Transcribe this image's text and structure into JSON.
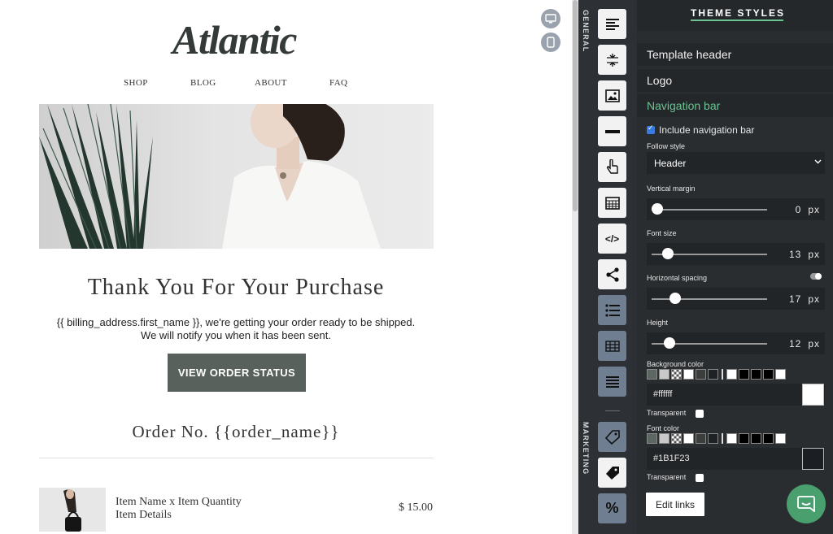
{
  "email": {
    "logo": "Atlantic",
    "nav": [
      "SHOP",
      "BLOG",
      "ABOUT",
      "FAQ"
    ],
    "title": "Thank You For Your Purchase",
    "message_line1": "{{ billing_address.first_name }}, we're getting your order ready to be shipped.",
    "message_line2": "We will notify you when it has been sent.",
    "cta_label": "VIEW ORDER STATUS",
    "order_label": "Order No. {{order_name}}",
    "item_line1": "Item Name x Item Quantity",
    "item_line2": "Item Details",
    "price": "$ 15.00"
  },
  "rail": {
    "general_label": "GENERAL",
    "marketing_label": "MARKETING",
    "tools": [
      {
        "icon": "header-align-icon"
      },
      {
        "icon": "spacer-icon"
      },
      {
        "icon": "image-icon"
      },
      {
        "icon": "divider-icon"
      },
      {
        "icon": "button-pointer-icon"
      },
      {
        "icon": "grid-block-icon"
      },
      {
        "icon": "html-code-icon",
        "text": "</>"
      },
      {
        "icon": "share-icon"
      },
      {
        "icon": "list-icon"
      },
      {
        "icon": "table-icon"
      },
      {
        "icon": "lines-icon"
      },
      {
        "icon": "tag-outline-icon"
      },
      {
        "icon": "tag-filled-icon"
      },
      {
        "icon": "percent-icon",
        "text": "%"
      }
    ]
  },
  "panel": {
    "title": "THEME STYLES",
    "sections": [
      "Template header",
      "Logo",
      "Navigation bar"
    ],
    "include_nav_label": "Include navigation bar",
    "follow_style_label": "Follow style",
    "follow_style_value": "Header",
    "vertical_margin_label": "Vertical margin",
    "vertical_margin_value": "0",
    "font_size_label": "Font size",
    "font_size_value": "13",
    "horizontal_spacing_label": "Horizontal spacing",
    "horizontal_spacing_value": "17",
    "height_label": "Height",
    "height_value": "12",
    "unit": "px",
    "background_color_label": "Background color",
    "background_color_value": "#ffffff",
    "font_color_label": "Font color",
    "font_color_value": "#1B1F23",
    "transparent_label": "Transparent",
    "edit_links_label": "Edit links",
    "swatch_colors": [
      "#5d6660",
      "#c9c9c9",
      "checker",
      "#ffffff",
      "#3b3e3c",
      "#1f2224",
      "sep",
      "#ffffff",
      "#000000",
      "#000000",
      "#000000",
      "#ffffff"
    ],
    "accent_color": "#6cc393"
  }
}
